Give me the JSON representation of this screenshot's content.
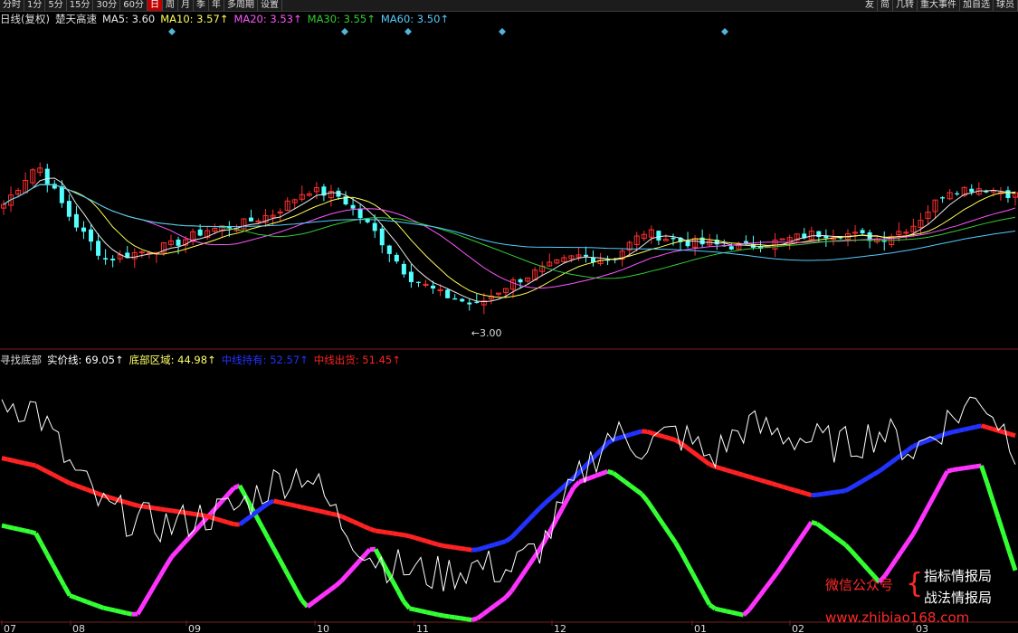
{
  "toolbar": {
    "left_items": [
      "分时",
      "1分",
      "5分",
      "15分",
      "30分",
      "60分",
      "日",
      "周",
      "月",
      "季",
      "年",
      "多周期",
      "设置"
    ],
    "active_item": "日",
    "right_items": [
      "友",
      "简",
      "几转",
      "重大事件",
      "加自选",
      "球员"
    ]
  },
  "main_legend": {
    "title": "日线(复权)",
    "stock": "楚天高速",
    "ma5": "MA5: 3.60",
    "ma10": "MA10: 3.57↑",
    "ma20": "MA20: 3.53↑",
    "ma30": "MA30: 3.55↑",
    "ma60": "MA60: 3.50↑",
    "colors": {
      "ma5": "#e8e8e8",
      "ma10": "#ffff55",
      "ma20": "#ff55ff",
      "ma30": "#33cc33",
      "ma60": "#55ccff"
    }
  },
  "sub_legend": {
    "title": "寻找底部",
    "real_line": "实价线: 69.05↑",
    "bottom_zone": "底部区域: 44.98↑",
    "mid_hold": "中线持有: 52.57↑",
    "mid_sell": "中线出货: 51.45↑",
    "colors": {
      "real_line": "#ffffff",
      "bottom_zone": "#ffff66",
      "mid_hold": "#2233ff",
      "mid_sell": "#ff2222"
    }
  },
  "price_annotation": "←3.00",
  "x_axis_labels": [
    "07",
    "08",
    "09",
    "10",
    "11",
    "12",
    "01",
    "02",
    "03"
  ],
  "watermark": {
    "wechat": "微信公众号",
    "line1": "指标情报局",
    "line2": "战法情报局",
    "url": "www.zhibiao168.com"
  },
  "chart_data": {
    "type": "candlestick+indicator",
    "main_panel": {
      "min_price_label": 3.0,
      "ma_latest": {
        "MA5": 3.6,
        "MA10": 3.57,
        "MA20": 3.53,
        "MA30": 3.55,
        "MA60": 3.5
      },
      "close_anchors": [
        3.58,
        3.8,
        3.5,
        3.28,
        3.32,
        3.36,
        3.44,
        3.47,
        3.53,
        3.66,
        3.62,
        3.43,
        3.19,
        3.09,
        3.03,
        3.15,
        3.23,
        3.3,
        3.28,
        3.43,
        3.38,
        3.36,
        3.35,
        3.38,
        3.42,
        3.42,
        3.39,
        3.47,
        3.66,
        3.67,
        3.63
      ]
    },
    "sub_panel": {
      "series": [
        {
          "name": "实价线",
          "latest": 69.05
        },
        {
          "name": "底部区域",
          "latest": 44.98
        },
        {
          "name": "中线持有",
          "latest": 52.57
        },
        {
          "name": "中线出货",
          "latest": 51.45
        }
      ],
      "real_line_anchors": [
        88,
        85,
        62,
        45,
        40,
        38,
        42,
        45,
        55,
        60,
        40,
        25,
        20,
        18,
        22,
        20,
        30,
        55,
        75,
        70,
        75,
        65,
        78,
        75,
        72,
        70,
        76,
        68,
        80,
        90,
        70
      ],
      "bottom_anchors": [
        38,
        35,
        10,
        5,
        2,
        25,
        40,
        55,
        30,
        5,
        15,
        30,
        5,
        2,
        0,
        10,
        30,
        55,
        60,
        50,
        30,
        5,
        2,
        20,
        40,
        30,
        15,
        35,
        60,
        62,
        20
      ],
      "mid_anchors": [
        65,
        62,
        55,
        50,
        46,
        44,
        42,
        38,
        48,
        45,
        42,
        36,
        34,
        30,
        28,
        32,
        46,
        58,
        72,
        76,
        72,
        62,
        58,
        54,
        50,
        52,
        60,
        70,
        75,
        78,
        74
      ]
    }
  }
}
